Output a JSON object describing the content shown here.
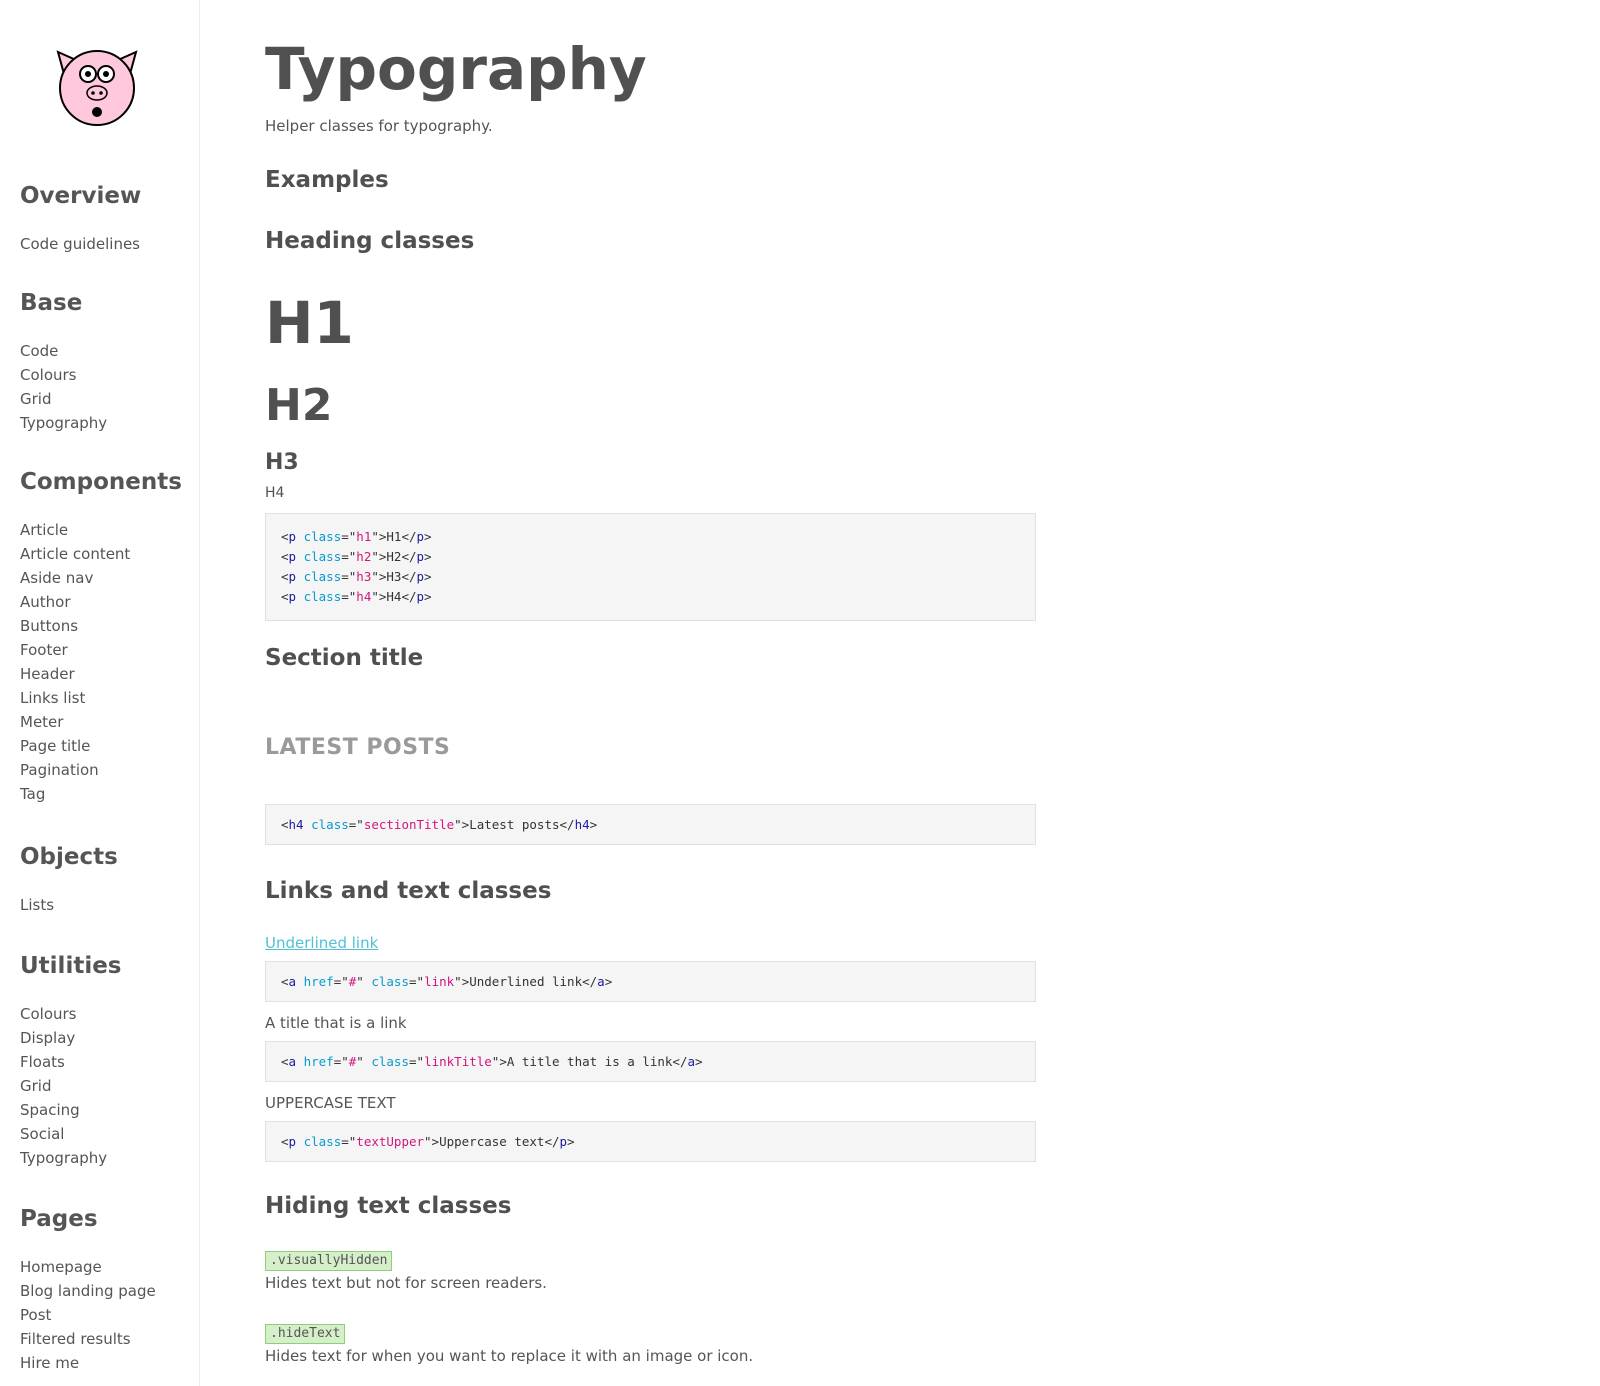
{
  "sidebar": {
    "sections": [
      {
        "title": "Overview",
        "items": [
          "Code guidelines"
        ]
      },
      {
        "title": "Base",
        "items": [
          "Code",
          "Colours",
          "Grid",
          "Typography"
        ]
      },
      {
        "title": "Components",
        "items": [
          "Article",
          "Article content",
          "Aside nav",
          "Author",
          "Buttons",
          "Footer",
          "Header",
          "Links list",
          "Meter",
          "Page title",
          "Pagination",
          "Tag"
        ]
      },
      {
        "title": "Objects",
        "items": [
          "Lists"
        ]
      },
      {
        "title": "Utilities",
        "items": [
          "Colours",
          "Display",
          "Floats",
          "Grid",
          "Spacing",
          "Social",
          "Typography"
        ]
      },
      {
        "title": "Pages",
        "items": [
          "Homepage",
          "Blog landing page",
          "Post",
          "Filtered results",
          "Hire me"
        ]
      }
    ]
  },
  "main": {
    "title": "Typography",
    "subtitle": "Helper classes for typography.",
    "examples_heading": "Examples",
    "heading_classes": {
      "title": "Heading classes",
      "h1": "H1",
      "h2": "H2",
      "h3": "H3",
      "h4": "H4",
      "code": [
        [
          "<",
          "p",
          " ",
          "class",
          "=\"",
          "h1",
          "\">H1</",
          "p",
          ">"
        ],
        [
          "<",
          "p",
          " ",
          "class",
          "=\"",
          "h2",
          "\">H2</",
          "p",
          ">"
        ],
        [
          "<",
          "p",
          " ",
          "class",
          "=\"",
          "h3",
          "\">H3</",
          "p",
          ">"
        ],
        [
          "<",
          "p",
          " ",
          "class",
          "=\"",
          "h4",
          "\">H4</",
          "p",
          ">"
        ]
      ]
    },
    "section_title": {
      "title": "Section title",
      "example": "LATEST POSTS",
      "code": [
        "<",
        "h4",
        " ",
        "class",
        "=\"",
        "sectionTitle",
        "\">Latest posts</",
        "h4",
        ">"
      ]
    },
    "links_text": {
      "title": "Links and text classes",
      "underlined_link": "Underlined link",
      "underlined_code": [
        "<",
        "a",
        " ",
        "href",
        "=\"",
        "#",
        "\" ",
        "class",
        "=\"",
        "link",
        "\">Underlined link</",
        "a",
        ">"
      ],
      "title_link": "A title that is a link",
      "title_link_code": [
        "<",
        "a",
        " ",
        "href",
        "=\"",
        "#",
        "\" ",
        "class",
        "=\"",
        "linkTitle",
        "\">A title that is a link</",
        "a",
        ">"
      ],
      "uppercase": "UPPERCASE TEXT",
      "uppercase_code": [
        "<",
        "p",
        " ",
        "class",
        "=\"",
        "textUpper",
        "\">Uppercase text</",
        "p",
        ">"
      ]
    },
    "hiding": {
      "title": "Hiding text classes",
      "visually_hidden": ".visuallyHidden",
      "visually_hidden_desc": "Hides text but not for screen readers.",
      "hide_text": ".hideText",
      "hide_text_desc": "Hides text for when you want to replace it with an image or icon."
    }
  },
  "colors": {
    "link": "#4fc1d4",
    "code_tag": "#1a1aa6",
    "code_attr": "#0a9acd",
    "code_value": "#d1177e",
    "badge_bg": "#d4efc9",
    "logo_pink": "#ffc8dd"
  }
}
